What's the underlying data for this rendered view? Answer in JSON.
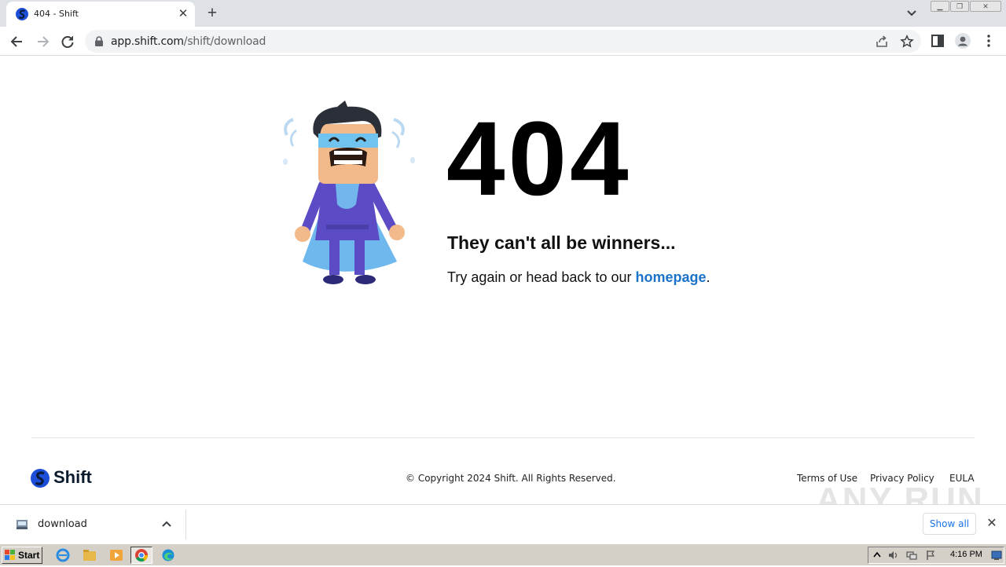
{
  "browser": {
    "tab": {
      "title": "404 - Shift",
      "close": "✕"
    },
    "new_tab": "+",
    "window_controls": {
      "minimize": "▁",
      "restore": "❐",
      "close": "✕"
    },
    "address": {
      "host": "app.shift.com",
      "path": "/shift/download"
    }
  },
  "page": {
    "error_code": "404",
    "tagline": "They can't all be winners...",
    "subtext_before": "Try again or head back to our ",
    "subtext_link": "homepage",
    "subtext_after": ".",
    "footer": {
      "brand": "Shift",
      "copyright": "© Copyright 2024 Shift. All Rights Reserved.",
      "links": [
        "Terms of Use",
        "Privacy Policy",
        "EULA"
      ]
    },
    "watermark": "ANY RUN"
  },
  "download_bar": {
    "file_name": "download",
    "show_all": "Show all",
    "close": "✕"
  },
  "taskbar": {
    "start_label": "Start",
    "clock": "4:16 PM"
  },
  "colors": {
    "link": "#1a73c8",
    "brand_blue": "#1d4ed8",
    "hero_purple": "#5b4bc4",
    "hero_cape": "#6fb8ee"
  }
}
